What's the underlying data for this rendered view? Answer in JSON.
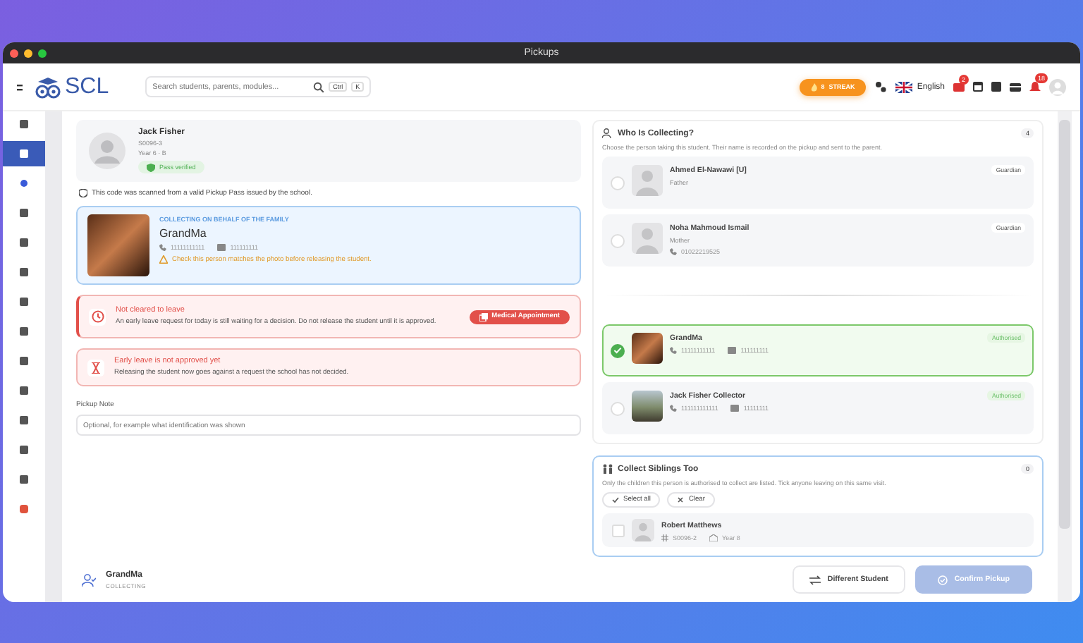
{
  "window": {
    "title": "Pickups"
  },
  "header": {
    "logo": "SCL",
    "search": {
      "placeholder": "Search students, parents, modules...",
      "keys": [
        "Ctrl",
        "K"
      ]
    },
    "streak": {
      "count": "8",
      "label": "STREAK"
    },
    "language": "English",
    "mail_badge": "2",
    "bell_badge": "18"
  },
  "sidebar": {
    "items": [
      {
        "selected": false
      },
      {
        "selected": true
      },
      {
        "selected": false
      },
      {
        "selected": false
      },
      {
        "selected": false
      },
      {
        "selected": false
      },
      {
        "selected": false
      },
      {
        "selected": false
      },
      {
        "selected": false
      },
      {
        "selected": false
      },
      {
        "selected": false
      },
      {
        "selected": false
      },
      {
        "selected": false
      },
      {
        "selected": false
      }
    ]
  },
  "student": {
    "name": "Jack Fisher",
    "id": "S0096-3",
    "class": "Year 6 · B",
    "badge": "Pass verified"
  },
  "scan_note": "This code was scanned from a valid Pickup Pass issued by the school.",
  "collector": {
    "label": "COLLECTING ON BEHALF OF THE FAMILY",
    "name": "GrandMa",
    "phone": "11111111111",
    "id_number": "111111111",
    "warning": "Check this person matches the photo before releasing the student."
  },
  "alerts": [
    {
      "kind": "clock",
      "title": "Not cleared to leave",
      "text": "An early leave request for today is still waiting for a decision. Do not release the student until it is approved.",
      "button": "Medical Appointment"
    },
    {
      "kind": "hourglass",
      "title": "Early leave is not approved yet",
      "text": "Releasing the student now goes against a request the school has not decided."
    }
  ],
  "pickup_note": {
    "label": "Pickup Note",
    "placeholder": "Optional, for example what identification was shown"
  },
  "who": {
    "title": "Who Is Collecting?",
    "count": "4",
    "description": "Choose the person taking this student. Their name is recorded on the pickup and sent to the parent.",
    "guardians": [
      {
        "kind": "avatar",
        "name": "Ahmed El-Nawawi [U]",
        "relation": "Father",
        "tag": "Guardian",
        "selected": false
      },
      {
        "kind": "avatar",
        "name": "Noha Mahmoud Ismail",
        "relation": "Mother",
        "phone": "01022219525",
        "tag": "Guardian",
        "selected": false
      }
    ],
    "authorised": [
      {
        "kind": "photo",
        "name": "GrandMa",
        "phone": "11111111111",
        "id_number": "111111111",
        "tag": "Authorised",
        "selected": true
      },
      {
        "kind": "landscape",
        "name": "Jack Fisher Collector",
        "phone": "111111111111",
        "id_number": "11111111",
        "tag": "Authorised",
        "selected": false
      }
    ]
  },
  "siblings": {
    "title": "Collect Siblings Too",
    "count": "0",
    "description": "Only the children this person is authorised to collect are listed. Tick anyone leaving on this same visit.",
    "select_all": "Select all",
    "clear": "Clear",
    "items": [
      {
        "name": "Robert Matthews",
        "id": "S0096-2",
        "year": "Year 8",
        "checked": false
      }
    ]
  },
  "footer": {
    "name": "GrandMa",
    "status": "COLLECTING",
    "different": "Different Student",
    "confirm": {
      "label": "Confirm Pickup",
      "disabled": true
    }
  }
}
